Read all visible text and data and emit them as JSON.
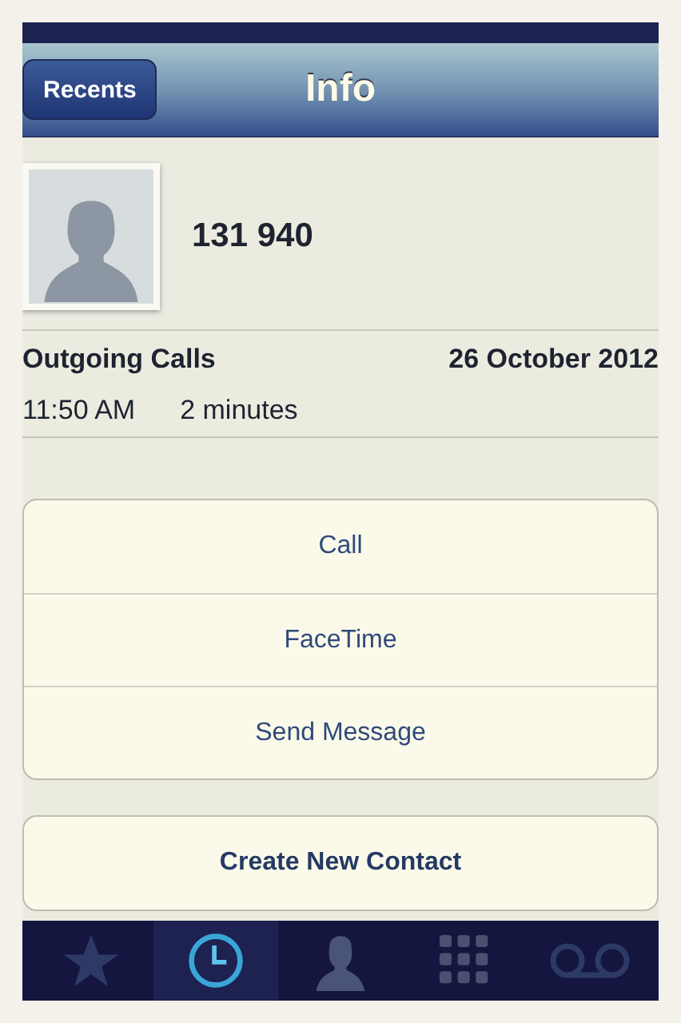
{
  "nav_bar": {
    "back_button": "Recents",
    "title": "Info"
  },
  "contact": {
    "name": "131 940"
  },
  "call_log": {
    "heading": "Outgoing Calls",
    "date": "26 October 2012",
    "time": "11:50 AM",
    "duration": "2 minutes"
  },
  "actions": [
    "Call",
    "FaceTime",
    "Send Message"
  ],
  "secondary_actions": [
    "Create New Contact"
  ],
  "tab_bar": [
    {
      "kind": "favorites",
      "selected": false
    },
    {
      "kind": "recents",
      "selected": true
    },
    {
      "kind": "contacts",
      "selected": false
    },
    {
      "kind": "keypad",
      "selected": false
    },
    {
      "kind": "voicemail",
      "selected": false
    }
  ]
}
